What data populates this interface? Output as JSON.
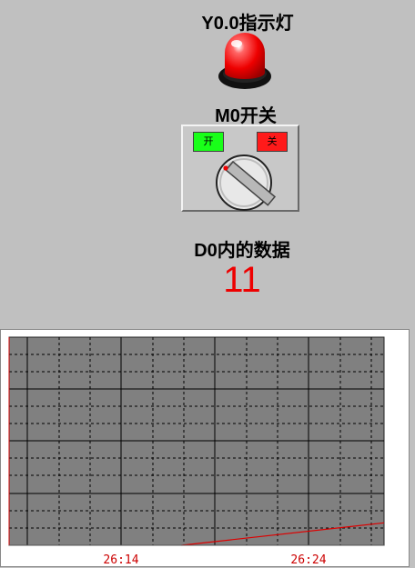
{
  "lamp": {
    "label": "Y0.0指示灯",
    "color": "#ee0000",
    "state": "on"
  },
  "switch": {
    "label": "M0开关",
    "on_label": "开",
    "off_label": "关",
    "on_color": "#19ff19",
    "off_color": "#ff1a1a"
  },
  "data_display": {
    "label": "D0内的数据",
    "value": "11",
    "value_color": "#ee0000"
  },
  "chart_data": {
    "type": "line",
    "x_tick_labels": [
      "26:14",
      "26:24"
    ],
    "series": [
      {
        "color": "#dd0000",
        "x": [
          0.46,
          1.0
        ],
        "y": [
          0.0,
          0.108
        ]
      }
    ],
    "xlim": [
      0,
      1
    ],
    "ylim": [
      0,
      1
    ],
    "grid": true,
    "background": "#808080"
  }
}
